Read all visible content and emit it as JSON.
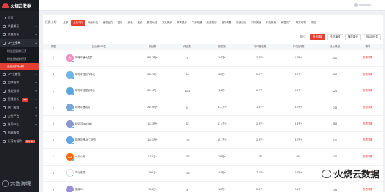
{
  "brand": {
    "name": "火烧云数据"
  },
  "sidebar": {
    "items": [
      {
        "label": "首页",
        "icon": "home-icon"
      },
      {
        "label": "大盘概况",
        "icon": "dashboard-icon"
      },
      {
        "label": "流量分析",
        "icon": "chart-icon"
      },
      {
        "label": "UP主榜单",
        "icon": "rank-icon",
        "open": true
      }
    ],
    "subitems": [
      {
        "label": "粉丝总量排行榜"
      },
      {
        "label": "粉丝涨幅排行榜"
      },
      {
        "label": "企业号排行榜",
        "active": true
      }
    ],
    "more": [
      {
        "label": "UP主查找",
        "icon": "search-icon"
      },
      {
        "label": "品牌营销",
        "icon": "brand-icon"
      },
      {
        "label": "视频分析",
        "icon": "video-icon"
      },
      {
        "label": "直播分析",
        "icon": "live-icon",
        "badge": "New"
      },
      {
        "label": "热门视频",
        "icon": "fire-icon"
      },
      {
        "label": "工作平台",
        "icon": "work-icon"
      },
      {
        "label": "账号中心",
        "icon": "user-icon"
      },
      {
        "label": "升级服务",
        "icon": "upgrade-icon"
      },
      {
        "label": "分享有福利",
        "icon": "gift-icon",
        "badge": "限时福利"
      }
    ]
  },
  "filters": {
    "label": "所属分类：",
    "chips": [
      "全部",
      "企业机构",
      "动画科技",
      "番剧官方",
      "音乐",
      "游戏",
      "生活",
      "影视动漫",
      "文化美术",
      "体育健身",
      "汽车交通",
      "美食厨房",
      "娱乐明星",
      "旅游出行",
      "时尚美妆",
      "科技数码",
      "家居房产",
      "萌宠动物",
      "其他"
    ],
    "active_index": 1
  },
  "sort": {
    "label": "排序：",
    "buttons": [
      "粉丝增量",
      "作品播放",
      "播放增长",
      "互动增长量"
    ],
    "active_index": 0
  },
  "table": {
    "headers": [
      "排名",
      "企业号/UP主",
      "粉丝数",
      "作品数",
      "播放数",
      "平均播放数",
      "平均互动数",
      "总点赞量",
      "操作"
    ],
    "rows": [
      {
        "rank": "1",
        "name": "哔哩哔哩大会员",
        "avatar_color": "#f08cc0",
        "avatar_text": "大",
        "fans": "836.3万+",
        "works": "3",
        "plays": "1.4亿+",
        "avg_play": "2.3千+",
        "avg_inter": "1.7千+",
        "likes": "536",
        "action": "查看详情"
      },
      {
        "rank": "2",
        "name": "哔哩哔哩创作中心",
        "avatar_color": "#6fb6e8",
        "avatar_text": "",
        "fans": "595.1万+",
        "works": "66",
        "plays": "6.3亿+",
        "avg_play": "2.3千+",
        "avg_inter": "4.0千+",
        "likes": "664",
        "action": "查看详情"
      },
      {
        "rank": "3",
        "name": "哔哩哔哩漫画中心",
        "avatar_color": "#5aa6e0",
        "avatar_text": "",
        "fans": "301.4万+",
        "works": "1344",
        "plays": "1.4亿+",
        "avg_play": "2.2千+",
        "avg_inter": "5.3千+",
        "likes": "224",
        "action": "查看详情"
      },
      {
        "rank": "4",
        "name": "哔哩哔哩活动",
        "avatar_color": "#7aa7d8",
        "avatar_text": "",
        "fans": "234.9万+",
        "works": "31",
        "plays": "31.7万+",
        "avg_play": "1.4千+",
        "avg_inter": "3.0千+",
        "likes": "343",
        "action": "查看详情"
      },
      {
        "rank": "5",
        "name": "EN23SongTalk",
        "avatar_color": "#8899cc",
        "avatar_text": "",
        "fans": "117.3万+",
        "works": "32",
        "plays": "17.4万+",
        "avg_play": "2.3千+",
        "avg_inter": "5.3千+",
        "likes": "564",
        "action": "查看详情"
      },
      {
        "rank": "6",
        "name": "哔哩哔哩UP主服务",
        "avatar_color": "#5fa4e4",
        "avatar_text": "",
        "fans": "114.1万+",
        "works": "133",
        "plays": "15.7万+",
        "avg_play": "2.3千+",
        "avg_inter": "4.2千+",
        "likes": "576",
        "action": "查看详情"
      },
      {
        "rank": "7",
        "name": "小米公司",
        "avatar_color": "#ff6900",
        "avatar_text": "mi",
        "fans": "91.1万+",
        "works": "272",
        "plays": "1.6万+",
        "avg_play": "511",
        "avg_inter": "581",
        "likes": "426",
        "action": "查看详情"
      },
      {
        "rank": "8",
        "name": "华为终端",
        "avatar_color": "#ffffff",
        "avatar_text": "",
        "fans": "76.6万+",
        "works": "188",
        "plays": "1.4万+",
        "avg_play": "7.1千+",
        "avg_inter": "2.2千+",
        "likes": "306",
        "action": "查看详情"
      },
      {
        "rank": "9",
        "name": "猫耳FM",
        "avatar_color": "#9a8fd8",
        "avatar_text": "",
        "fans": "70.4万+",
        "works": "8",
        "plays": "1.3万+",
        "avg_play": "2.4千+",
        "avg_inter": "2.3千+",
        "likes": "198",
        "action": "查看详情"
      }
    ]
  },
  "watermark_left": {
    "text": "大数跨境"
  },
  "watermark_right": {
    "text": "火烧云数据"
  }
}
